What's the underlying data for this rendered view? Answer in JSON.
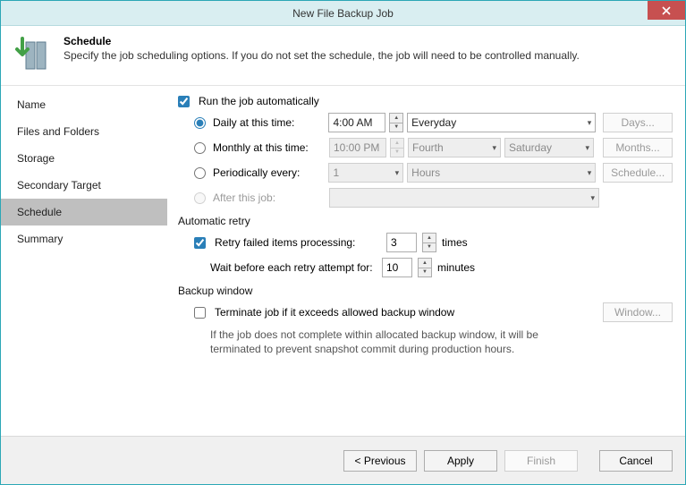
{
  "window": {
    "title": "New File Backup Job"
  },
  "header": {
    "title": "Schedule",
    "subtitle": "Specify the job scheduling options. If you do not set the schedule, the job will need to be controlled manually."
  },
  "sidebar": {
    "items": [
      {
        "label": "Name"
      },
      {
        "label": "Files and Folders"
      },
      {
        "label": "Storage"
      },
      {
        "label": "Secondary Target"
      },
      {
        "label": "Schedule"
      },
      {
        "label": "Summary"
      }
    ],
    "active_index": 4
  },
  "schedule": {
    "run_automatically_label": "Run the job automatically",
    "run_automatically_checked": true,
    "daily_label": "Daily at this time:",
    "daily_time": "4:00 AM",
    "daily_scope": "Everyday",
    "days_btn": "Days...",
    "monthly_label": "Monthly at this time:",
    "monthly_time": "10:00 PM",
    "monthly_ordinal": "Fourth",
    "monthly_day": "Saturday",
    "months_btn": "Months...",
    "periodic_label": "Periodically every:",
    "periodic_value": "1",
    "periodic_unit": "Hours",
    "schedule_btn": "Schedule...",
    "after_label": "After this job:",
    "after_value": ""
  },
  "retry": {
    "section_title": "Automatic retry",
    "retry_checked": true,
    "retry_label": "Retry failed items processing:",
    "retry_count": "3",
    "retry_times": "times",
    "wait_label": "Wait before each retry attempt for:",
    "wait_minutes": "10",
    "minutes_label": "minutes"
  },
  "backup_window": {
    "section_title": "Backup window",
    "terminate_checked": false,
    "terminate_label": "Terminate job if it exceeds allowed backup window",
    "window_btn": "Window...",
    "note": "If the job does not complete within allocated backup window, it will be terminated to prevent snapshot commit during production hours."
  },
  "footer": {
    "previous": "< Previous",
    "apply": "Apply",
    "finish": "Finish",
    "cancel": "Cancel"
  }
}
